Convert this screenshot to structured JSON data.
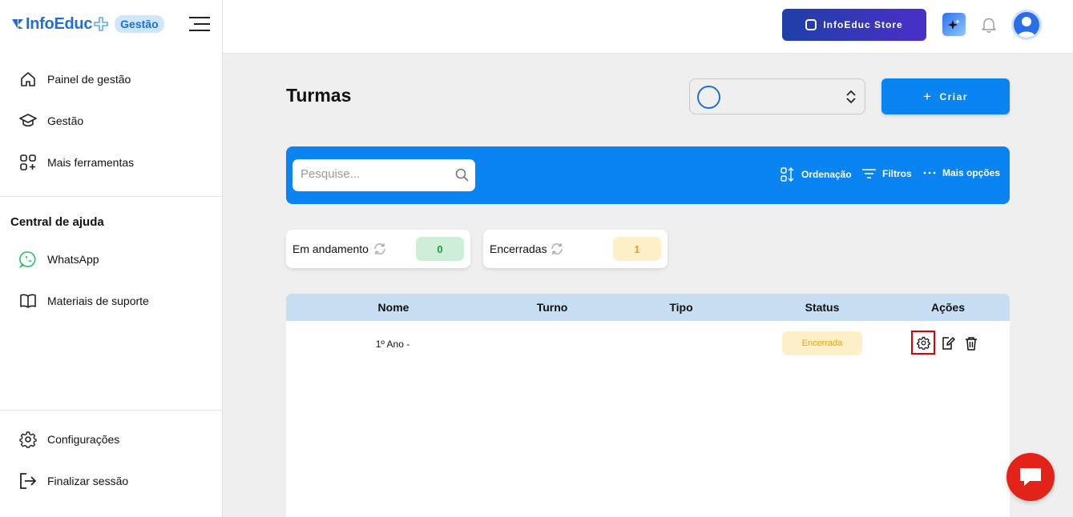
{
  "brand": {
    "name": "InfoEduc",
    "badge": "Gestão",
    "color": "#1f6fd6"
  },
  "sidebar": {
    "items": [
      {
        "label": "Painel de gestão",
        "icon": "home-icon"
      },
      {
        "label": "Gestão",
        "icon": "graduation-cap-icon"
      },
      {
        "label": "Mais ferramentas",
        "icon": "grid-plus-icon"
      }
    ],
    "help_title": "Central de ajuda",
    "help_items": [
      {
        "label": "WhatsApp",
        "icon": "whatsapp-icon"
      },
      {
        "label": "Materiais de suporte",
        "icon": "book-icon"
      }
    ],
    "bottom_items": [
      {
        "label": "Configurações",
        "icon": "gear-icon"
      },
      {
        "label": "Finalizar sessão",
        "icon": "logout-icon"
      }
    ]
  },
  "topbar": {
    "store_label": "InfoEduc Store"
  },
  "main": {
    "title": "Turmas",
    "create_label": "Criar",
    "search_placeholder": "Pesquise...",
    "tools": {
      "sort": "Ordenação",
      "filters": "Filtros",
      "more": "Mais opções"
    },
    "stats": [
      {
        "label": "Em andamento",
        "count": "0",
        "bg": "#cfeed7",
        "color": "#1a9c3c"
      },
      {
        "label": "Encerradas",
        "count": "1",
        "bg": "#fdefc8",
        "color": "#e8a312"
      }
    ],
    "table": {
      "columns": [
        "Nome",
        "Turno",
        "Tipo",
        "Status",
        "Ações"
      ],
      "rows": [
        {
          "nome": "1º Ano -",
          "turno": "",
          "tipo": "",
          "status": "Encerrada"
        }
      ]
    }
  },
  "colors": {
    "accent": "#0a84f0",
    "header_row": "#c7def3",
    "chat": "#e3231a"
  }
}
